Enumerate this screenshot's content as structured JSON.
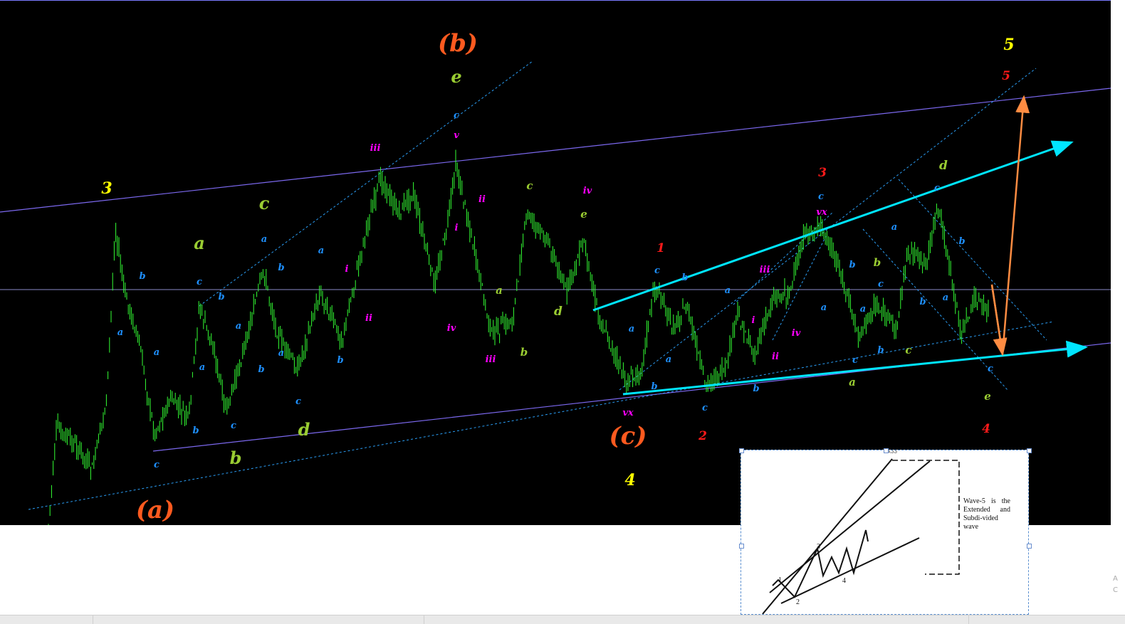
{
  "colors": {
    "background": "#000000",
    "candles": "#33ff33",
    "channel": "#7b68ee",
    "dotted": "#2a9df4",
    "trend": "#00e5ff",
    "arrow": "#ff8c42",
    "orange_label": "#ff5a1f",
    "yellow_label": "#ffff00",
    "green_label": "#9acd32",
    "magenta_label": "#ff00ff",
    "cyan_label": "#1e90ff",
    "red_label": "#ff1a1a"
  },
  "chart_data": {
    "type": "candlestick",
    "wave_labels": [
      {
        "text": "(a)",
        "color": "orange"
      },
      {
        "text": "(b)",
        "color": "orange"
      },
      {
        "text": "(c)",
        "color": "orange"
      },
      {
        "text": "3",
        "color": "yellow"
      },
      {
        "text": "4",
        "color": "yellow"
      },
      {
        "text": "5",
        "color": "yellow"
      },
      {
        "text": "a",
        "color": "green"
      },
      {
        "text": "b",
        "color": "green"
      },
      {
        "text": "c",
        "color": "green"
      },
      {
        "text": "d",
        "color": "green"
      },
      {
        "text": "e",
        "color": "green"
      },
      {
        "text": "1",
        "color": "red"
      },
      {
        "text": "2",
        "color": "red"
      },
      {
        "text": "3",
        "color": "red"
      },
      {
        "text": "4",
        "color": "red"
      },
      {
        "text": "5",
        "color": "red"
      },
      {
        "text": "i",
        "color": "magenta"
      },
      {
        "text": "ii",
        "color": "magenta"
      },
      {
        "text": "iii",
        "color": "magenta"
      },
      {
        "text": "iv",
        "color": "magenta"
      },
      {
        "text": "v",
        "color": "magenta"
      },
      {
        "text": "vx",
        "color": "magenta"
      }
    ]
  },
  "inset": {
    "note": "Wave-5 is the Extended and Subdi-vided wave",
    "top_label": "x33",
    "wave_numbers": [
      "1",
      "2",
      "3",
      "4"
    ]
  },
  "edge_glyphs": [
    "A",
    "C"
  ]
}
